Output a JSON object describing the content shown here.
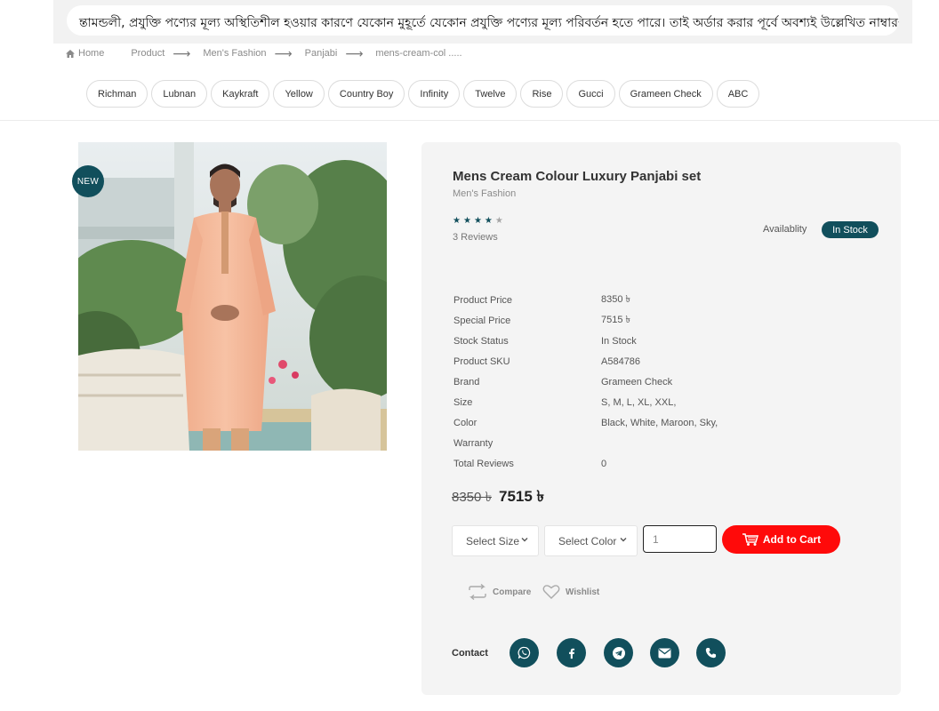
{
  "notice": {
    "text": "ন্তামন্ডলী, প্রযুক্তি পণ্যের মূল্য অস্থিতিশীল হওয়ার কারণে যেকোন মুহূর্তে যেকোন প্রযুক্তি পণ্যের মূল্য পরিবর্তন হতে পারে। তাই অর্ডার করার পূর্বে অবশ্যই উল্লেখিত নাম্বারগুলোতে"
  },
  "breadcrumb": {
    "home": "Home",
    "items": [
      "Product",
      "Men's Fashion",
      "Panjabi",
      "mens-cream-col ....."
    ],
    "separator": "⟶"
  },
  "brands": [
    "Richman",
    "Lubnan",
    "Kaykraft",
    "Yellow",
    "Country Boy",
    "Infinity",
    "Twelve",
    "Rise",
    "Gucci",
    "Grameen Check",
    "ABC"
  ],
  "product": {
    "badge": "NEW",
    "title": "Mens Cream Colour Luxury Panjabi set",
    "category": "Men's Fashion",
    "rating": 4,
    "rating_max": 5,
    "reviews": "3 Reviews",
    "availability_label": "Availablity",
    "availability": "In Stock",
    "specs": [
      {
        "label": "Product Price",
        "value": "8350 ৳"
      },
      {
        "label": "Special Price",
        "value": "7515 ৳"
      },
      {
        "label": "Stock Status",
        "value": "In Stock"
      },
      {
        "label": "Product SKU",
        "value": "A584786"
      },
      {
        "label": "Brand",
        "value": "Grameen Check"
      },
      {
        "label": "Size",
        "value": "S, M, L, XL, XXL,"
      },
      {
        "label": "Color",
        "value": "Black, White, Maroon, Sky,"
      },
      {
        "label": "Warranty",
        "value": ""
      },
      {
        "label": "Total Reviews",
        "value": "0"
      }
    ],
    "old_price": "8350 ৳",
    "new_price": "7515 ৳"
  },
  "purchase": {
    "size_select": "Select Size",
    "color_select": "Select Color",
    "quantity": "1",
    "add_to_cart": "Add to Cart"
  },
  "actions": {
    "compare": "Compare",
    "wishlist": "Wishlist"
  },
  "contact": {
    "label": "Contact",
    "icons": [
      "whatsapp-icon",
      "facebook-icon",
      "telegram-icon",
      "email-icon",
      "phone-icon"
    ]
  },
  "colors": {
    "accent": "#114f5c",
    "cart": "#ff0a0a",
    "panel": "#f4f4f4"
  }
}
